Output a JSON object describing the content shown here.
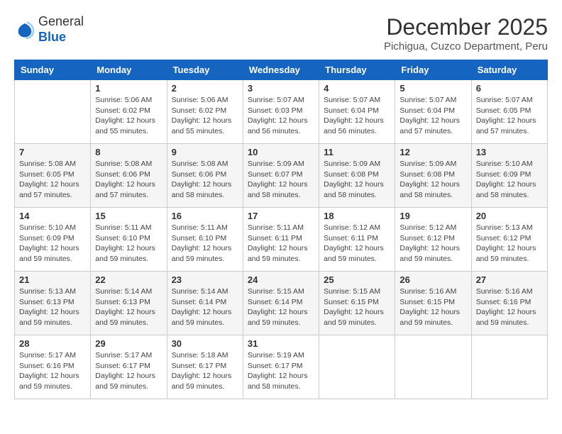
{
  "logo": {
    "general": "General",
    "blue": "Blue"
  },
  "title": {
    "month_year": "December 2025",
    "location": "Pichigua, Cuzco Department, Peru"
  },
  "calendar": {
    "headers": [
      "Sunday",
      "Monday",
      "Tuesday",
      "Wednesday",
      "Thursday",
      "Friday",
      "Saturday"
    ],
    "weeks": [
      {
        "days": [
          {
            "number": "",
            "sunrise": "",
            "sunset": "",
            "daylight": "",
            "empty": true
          },
          {
            "number": "1",
            "sunrise": "Sunrise: 5:06 AM",
            "sunset": "Sunset: 6:02 PM",
            "daylight": "Daylight: 12 hours and 55 minutes.",
            "empty": false
          },
          {
            "number": "2",
            "sunrise": "Sunrise: 5:06 AM",
            "sunset": "Sunset: 6:02 PM",
            "daylight": "Daylight: 12 hours and 55 minutes.",
            "empty": false
          },
          {
            "number": "3",
            "sunrise": "Sunrise: 5:07 AM",
            "sunset": "Sunset: 6:03 PM",
            "daylight": "Daylight: 12 hours and 56 minutes.",
            "empty": false
          },
          {
            "number": "4",
            "sunrise": "Sunrise: 5:07 AM",
            "sunset": "Sunset: 6:04 PM",
            "daylight": "Daylight: 12 hours and 56 minutes.",
            "empty": false
          },
          {
            "number": "5",
            "sunrise": "Sunrise: 5:07 AM",
            "sunset": "Sunset: 6:04 PM",
            "daylight": "Daylight: 12 hours and 57 minutes.",
            "empty": false
          },
          {
            "number": "6",
            "sunrise": "Sunrise: 5:07 AM",
            "sunset": "Sunset: 6:05 PM",
            "daylight": "Daylight: 12 hours and 57 minutes.",
            "empty": false
          }
        ]
      },
      {
        "days": [
          {
            "number": "7",
            "sunrise": "Sunrise: 5:08 AM",
            "sunset": "Sunset: 6:05 PM",
            "daylight": "Daylight: 12 hours and 57 minutes.",
            "empty": false
          },
          {
            "number": "8",
            "sunrise": "Sunrise: 5:08 AM",
            "sunset": "Sunset: 6:06 PM",
            "daylight": "Daylight: 12 hours and 57 minutes.",
            "empty": false
          },
          {
            "number": "9",
            "sunrise": "Sunrise: 5:08 AM",
            "sunset": "Sunset: 6:06 PM",
            "daylight": "Daylight: 12 hours and 58 minutes.",
            "empty": false
          },
          {
            "number": "10",
            "sunrise": "Sunrise: 5:09 AM",
            "sunset": "Sunset: 6:07 PM",
            "daylight": "Daylight: 12 hours and 58 minutes.",
            "empty": false
          },
          {
            "number": "11",
            "sunrise": "Sunrise: 5:09 AM",
            "sunset": "Sunset: 6:08 PM",
            "daylight": "Daylight: 12 hours and 58 minutes.",
            "empty": false
          },
          {
            "number": "12",
            "sunrise": "Sunrise: 5:09 AM",
            "sunset": "Sunset: 6:08 PM",
            "daylight": "Daylight: 12 hours and 58 minutes.",
            "empty": false
          },
          {
            "number": "13",
            "sunrise": "Sunrise: 5:10 AM",
            "sunset": "Sunset: 6:09 PM",
            "daylight": "Daylight: 12 hours and 58 minutes.",
            "empty": false
          }
        ]
      },
      {
        "days": [
          {
            "number": "14",
            "sunrise": "Sunrise: 5:10 AM",
            "sunset": "Sunset: 6:09 PM",
            "daylight": "Daylight: 12 hours and 59 minutes.",
            "empty": false
          },
          {
            "number": "15",
            "sunrise": "Sunrise: 5:11 AM",
            "sunset": "Sunset: 6:10 PM",
            "daylight": "Daylight: 12 hours and 59 minutes.",
            "empty": false
          },
          {
            "number": "16",
            "sunrise": "Sunrise: 5:11 AM",
            "sunset": "Sunset: 6:10 PM",
            "daylight": "Daylight: 12 hours and 59 minutes.",
            "empty": false
          },
          {
            "number": "17",
            "sunrise": "Sunrise: 5:11 AM",
            "sunset": "Sunset: 6:11 PM",
            "daylight": "Daylight: 12 hours and 59 minutes.",
            "empty": false
          },
          {
            "number": "18",
            "sunrise": "Sunrise: 5:12 AM",
            "sunset": "Sunset: 6:11 PM",
            "daylight": "Daylight: 12 hours and 59 minutes.",
            "empty": false
          },
          {
            "number": "19",
            "sunrise": "Sunrise: 5:12 AM",
            "sunset": "Sunset: 6:12 PM",
            "daylight": "Daylight: 12 hours and 59 minutes.",
            "empty": false
          },
          {
            "number": "20",
            "sunrise": "Sunrise: 5:13 AM",
            "sunset": "Sunset: 6:12 PM",
            "daylight": "Daylight: 12 hours and 59 minutes.",
            "empty": false
          }
        ]
      },
      {
        "days": [
          {
            "number": "21",
            "sunrise": "Sunrise: 5:13 AM",
            "sunset": "Sunset: 6:13 PM",
            "daylight": "Daylight: 12 hours and 59 minutes.",
            "empty": false
          },
          {
            "number": "22",
            "sunrise": "Sunrise: 5:14 AM",
            "sunset": "Sunset: 6:13 PM",
            "daylight": "Daylight: 12 hours and 59 minutes.",
            "empty": false
          },
          {
            "number": "23",
            "sunrise": "Sunrise: 5:14 AM",
            "sunset": "Sunset: 6:14 PM",
            "daylight": "Daylight: 12 hours and 59 minutes.",
            "empty": false
          },
          {
            "number": "24",
            "sunrise": "Sunrise: 5:15 AM",
            "sunset": "Sunset: 6:14 PM",
            "daylight": "Daylight: 12 hours and 59 minutes.",
            "empty": false
          },
          {
            "number": "25",
            "sunrise": "Sunrise: 5:15 AM",
            "sunset": "Sunset: 6:15 PM",
            "daylight": "Daylight: 12 hours and 59 minutes.",
            "empty": false
          },
          {
            "number": "26",
            "sunrise": "Sunrise: 5:16 AM",
            "sunset": "Sunset: 6:15 PM",
            "daylight": "Daylight: 12 hours and 59 minutes.",
            "empty": false
          },
          {
            "number": "27",
            "sunrise": "Sunrise: 5:16 AM",
            "sunset": "Sunset: 6:16 PM",
            "daylight": "Daylight: 12 hours and 59 minutes.",
            "empty": false
          }
        ]
      },
      {
        "days": [
          {
            "number": "28",
            "sunrise": "Sunrise: 5:17 AM",
            "sunset": "Sunset: 6:16 PM",
            "daylight": "Daylight: 12 hours and 59 minutes.",
            "empty": false
          },
          {
            "number": "29",
            "sunrise": "Sunrise: 5:17 AM",
            "sunset": "Sunset: 6:17 PM",
            "daylight": "Daylight: 12 hours and 59 minutes.",
            "empty": false
          },
          {
            "number": "30",
            "sunrise": "Sunrise: 5:18 AM",
            "sunset": "Sunset: 6:17 PM",
            "daylight": "Daylight: 12 hours and 59 minutes.",
            "empty": false
          },
          {
            "number": "31",
            "sunrise": "Sunrise: 5:19 AM",
            "sunset": "Sunset: 6:17 PM",
            "daylight": "Daylight: 12 hours and 58 minutes.",
            "empty": false
          },
          {
            "number": "",
            "sunrise": "",
            "sunset": "",
            "daylight": "",
            "empty": true
          },
          {
            "number": "",
            "sunrise": "",
            "sunset": "",
            "daylight": "",
            "empty": true
          },
          {
            "number": "",
            "sunrise": "",
            "sunset": "",
            "daylight": "",
            "empty": true
          }
        ]
      }
    ]
  }
}
